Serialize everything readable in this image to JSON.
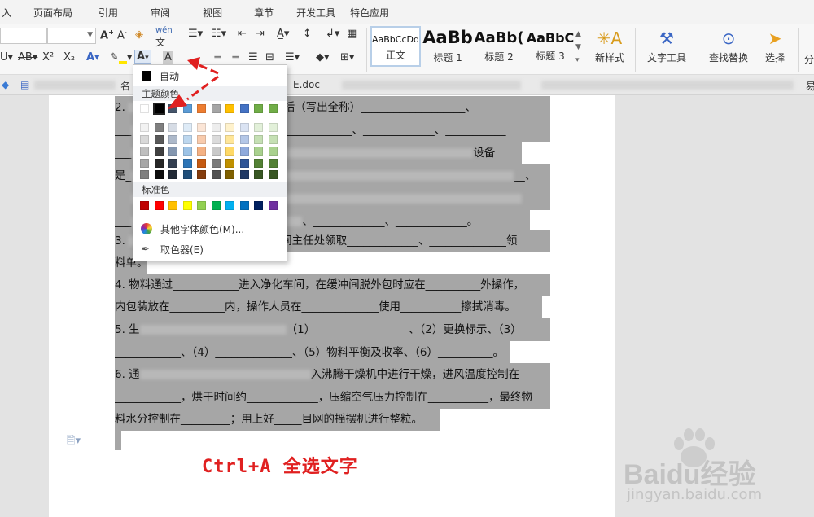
{
  "menu": {
    "items": [
      {
        "label": "入"
      },
      {
        "label": "页面布局"
      },
      {
        "label": "引用"
      },
      {
        "label": "审阅"
      },
      {
        "label": "视图"
      },
      {
        "label": "章节"
      },
      {
        "label": "开发工具"
      },
      {
        "label": "特色应用"
      }
    ]
  },
  "ribbon": {
    "styles": [
      {
        "sample": "AaBbCcDd",
        "label": "正文"
      },
      {
        "sample": "AaBb",
        "label": "标题 1"
      },
      {
        "sample": "AaBb(",
        "label": "标题 2"
      },
      {
        "sample": "AaBbC",
        "label": "标题 3"
      }
    ],
    "new_style_label": "新样式",
    "text_tools_label": "文字工具",
    "find_replace_label": "查找替换",
    "select_label": "选择",
    "split_label": "分"
  },
  "tabs": {
    "doc_tab_suffix": "E.doc",
    "doc_tab_left": "名",
    "right_edge": "易"
  },
  "color_menu": {
    "auto_label": "自动",
    "theme_header": "主题颜色",
    "standard_header": "标准色",
    "more_colors_label": "其他字体颜色(M)...",
    "eyedropper_label": "取色器(E)",
    "theme_top": [
      "#ffffff",
      "#000000",
      "#44546a",
      "#5b9bd5",
      "#ed7d31",
      "#a5a5a5",
      "#ffc000",
      "#4472c4",
      "#70ad47",
      "#70ad47"
    ],
    "theme_shades": [
      [
        "#f2f2f2",
        "#7f7f7f",
        "#d6dce5",
        "#deebf7",
        "#fbe5d6",
        "#ededed",
        "#fff2cc",
        "#dae3f3",
        "#e2f0d9",
        "#e2f0d9"
      ],
      [
        "#d9d9d9",
        "#595959",
        "#adb9ca",
        "#bdd7ee",
        "#f8cbad",
        "#dbdbdb",
        "#ffe699",
        "#b4c7e7",
        "#c5e0b4",
        "#c5e0b4"
      ],
      [
        "#bfbfbf",
        "#404040",
        "#8497b0",
        "#9dc3e6",
        "#f4b183",
        "#c9c9c9",
        "#ffd966",
        "#8faadc",
        "#a9d18e",
        "#a9d18e"
      ],
      [
        "#a6a6a6",
        "#262626",
        "#333f50",
        "#2e75b6",
        "#c55a11",
        "#7b7b7b",
        "#bf9000",
        "#2f5597",
        "#538135",
        "#538135"
      ],
      [
        "#7f7f7f",
        "#0d0d0d",
        "#222a35",
        "#1f4e79",
        "#843c0c",
        "#525252",
        "#7f6000",
        "#203864",
        "#385723",
        "#385723"
      ]
    ],
    "standard": [
      "#c00000",
      "#ff0000",
      "#ffc000",
      "#ffff00",
      "#92d050",
      "#00b050",
      "#00b0f0",
      "#0070c0",
      "#002060",
      "#7030a0"
    ]
  },
  "document": {
    "lines": [
      {
        "text": "2.  ",
        "mid": "台，包括（写出全称）___________________、"
      },
      {
        "text": "___",
        "mid": "、_____________、_____________、___________"
      },
      {
        "text": "___",
        "mid": "设备"
      },
      {
        "text": "是_",
        "mid": "__、"
      },
      {
        "text": "___",
        "mid": "__"
      },
      {
        "text": "___",
        "mid": "、_____________、_____________。"
      },
      {
        "text": "3.  ",
        "mid": "者车间主任处领取_____________、______________领"
      },
      {
        "text": "料单。",
        "mid": ""
      },
      {
        "text": "4.  物料通过____________进入净化车间，在缓冲间脱外包时应在__________外操作，",
        "mid": ""
      },
      {
        "text": "内包装放在__________内，操作人员在______________使用___________擦拭消毒。",
        "mid": ""
      },
      {
        "text": "5.  生",
        "mid": "（1）_________________、（2）更换标示、（3）____"
      },
      {
        "text": "____________、（4）______________、（5）物料平衡及收率、（6）__________。",
        "mid": ""
      },
      {
        "text": "6.  通",
        "mid": "入沸腾干燥机中进行干燥，进风温度控制在"
      },
      {
        "text": "____________，烘干时间约_____________，压缩空气压力控制在___________，最终物",
        "mid": ""
      },
      {
        "text": "料水分控制在_________；用上好_____目网的摇摆机进行整粒。",
        "mid": ""
      }
    ]
  },
  "annotation": {
    "caption": "Ctrl+A  全选文字"
  },
  "watermark": {
    "brand": "Baidu经验",
    "url": "jingyan.baidu.com"
  }
}
